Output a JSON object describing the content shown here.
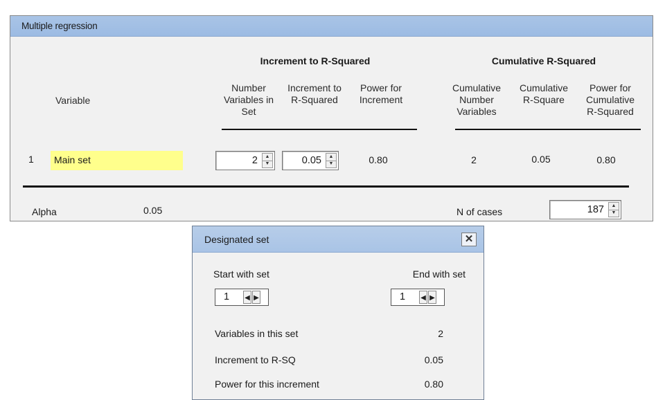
{
  "main_window": {
    "title": "Multiple regression",
    "increment_group_title": "Increment to R-Squared",
    "cumulative_group_title": "Cumulative R-Squared",
    "col_variable": "Variable",
    "col_number_vars": [
      "Number",
      "Variables in",
      "Set"
    ],
    "col_increment": [
      "Increment to",
      "R-Squared"
    ],
    "col_power_increment": [
      "Power for",
      "Increment"
    ],
    "col_cum_number": [
      "Cumulative",
      "Number",
      "Variables"
    ],
    "col_cum_rsquare": [
      "Cumulative",
      "R-Square"
    ],
    "col_power_cumulative": [
      "Power for",
      "Cumulative",
      "R-Squared"
    ],
    "row": {
      "index": "1",
      "name": "Main set",
      "number_vars": "2",
      "increment": "0.05",
      "power_increment": "0.80",
      "cum_number": "2",
      "cum_rsquare": "0.05",
      "power_cumulative": "0.80"
    },
    "alpha_label": "Alpha",
    "alpha_value": "0.05",
    "n_cases_label": "N of cases",
    "n_cases_value": "187"
  },
  "dialog": {
    "title": "Designated set",
    "start_label": "Start with set",
    "start_value": "1",
    "end_label": "End with set",
    "end_value": "1",
    "vars_label": "Variables in this set",
    "vars_value": "2",
    "increment_label": "Increment to R-SQ",
    "increment_value": "0.05",
    "power_label": "Power for this increment",
    "power_value": "0.80"
  },
  "colors": {
    "titlebar": "#9cbbe3",
    "highlight_yellow": "#ffff8c",
    "panel_bg": "#f1f1f1"
  },
  "icons": {
    "close": "close-icon",
    "spin_up": "spin-up-icon",
    "spin_down": "spin-down-icon",
    "nav_left": "arrow-left-icon",
    "nav_right": "arrow-right-icon"
  }
}
